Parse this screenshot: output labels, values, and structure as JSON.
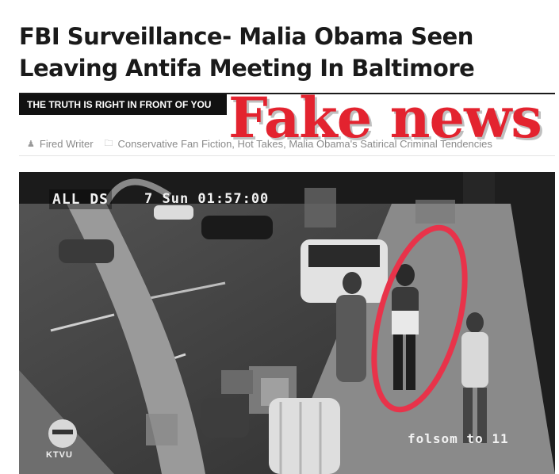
{
  "article": {
    "title": "FBI Surveillance- Malia Obama Seen Leaving Antifa Meeting In Baltimore",
    "tagline": "THE TRUTH IS RIGHT IN FRONT OF YOU",
    "stamp": "Fake news",
    "author": "Fired Writer",
    "categories": "Conservative Fan Fiction, Hot Takes, Malia Obama's Satirical Criminal Tendencies"
  },
  "photo": {
    "logo": "ALL DS",
    "timestamp": "7 Sun 01:57:00",
    "location": "folsom to 11",
    "station": "KTVU",
    "highlight_color": "#e8334a"
  },
  "icons": {
    "author": "person-icon",
    "category": "folder-icon"
  }
}
